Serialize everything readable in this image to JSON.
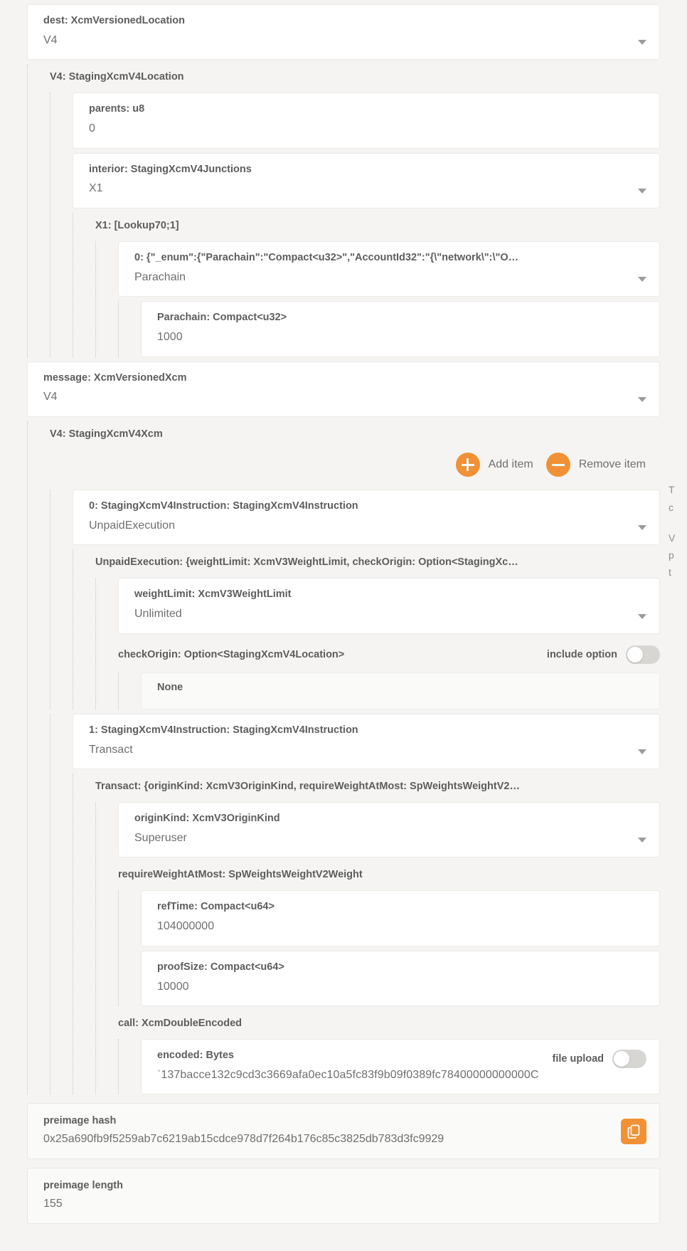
{
  "colors": {
    "accent": "#f19135",
    "page_bg": "#f5f4f2",
    "card_bg": "#ffffff",
    "label_text": "#5d5d5d",
    "value_text": "#6f6f6f",
    "toggle_track": "#d8d6d3"
  },
  "dest": {
    "label": "dest: XcmVersionedLocation",
    "value": "V4",
    "section": "V4: StagingXcmV4Location",
    "parents": {
      "label": "parents: u8",
      "value": "0"
    },
    "interior": {
      "label": "interior: StagingXcmV4Junctions",
      "value": "X1"
    },
    "x1_section": "X1: [Lookup70;1]",
    "junction": {
      "label": "0: {\"_enum\":{\"Parachain\":\"Compact<u32>\",\"AccountId32\":\"{\\\"network\\\":\\\"O…",
      "value": "Parachain"
    },
    "parachain": {
      "label": "Parachain: Compact<u32>",
      "value": "1000"
    }
  },
  "message": {
    "label": "message: XcmVersionedXcm",
    "value": "V4",
    "section": "V4: StagingXcmV4Xcm",
    "add_item_label": "Add item",
    "remove_item_label": "Remove item",
    "instructions": [
      {
        "label": "0: StagingXcmV4Instruction: StagingXcmV4Instruction",
        "value": "UnpaidExecution",
        "section": "UnpaidExecution: {weightLimit: XcmV3WeightLimit, checkOrigin: Option<StagingXc…",
        "weight_limit": {
          "label": "weightLimit: XcmV3WeightLimit",
          "value": "Unlimited"
        },
        "check_origin": {
          "label": "checkOrigin: Option<StagingXcmV4Location>",
          "toggle_label": "include option",
          "toggle_on": false,
          "none_value": "None"
        }
      },
      {
        "label": "1: StagingXcmV4Instruction: StagingXcmV4Instruction",
        "value": "Transact",
        "section": "Transact: {originKind: XcmV3OriginKind, requireWeightAtMost: SpWeightsWeightV2…",
        "origin_kind": {
          "label": "originKind: XcmV3OriginKind",
          "value": "Superuser"
        },
        "require_weight_section": "requireWeightAtMost: SpWeightsWeightV2Weight",
        "ref_time": {
          "label": "refTime: Compact<u64>",
          "value": "104000000"
        },
        "proof_size": {
          "label": "proofSize: Compact<u64>",
          "value": "10000"
        },
        "call_section": "call: XcmDoubleEncoded",
        "encoded": {
          "label": "encoded: Bytes",
          "toggle_label": "file upload",
          "toggle_on": false,
          "value": "ˈ137bacce132c9cd3c3669afa0ec10a5fc83f9b09f0389fc78400000000000C"
        }
      }
    ]
  },
  "preimage_hash": {
    "label": "preimage hash",
    "value": "0x25a690fb9f5259ab7c6219ab15cdce978d7f264b176c85c3825db783d3fc9929",
    "copy_icon": "copy-icon"
  },
  "preimage_length": {
    "label": "preimage length",
    "value": "155"
  },
  "right_fragments": {
    "frag1": "T",
    "frag2": "c",
    "frag3": "V",
    "frag4": "p",
    "frag5": "t"
  }
}
